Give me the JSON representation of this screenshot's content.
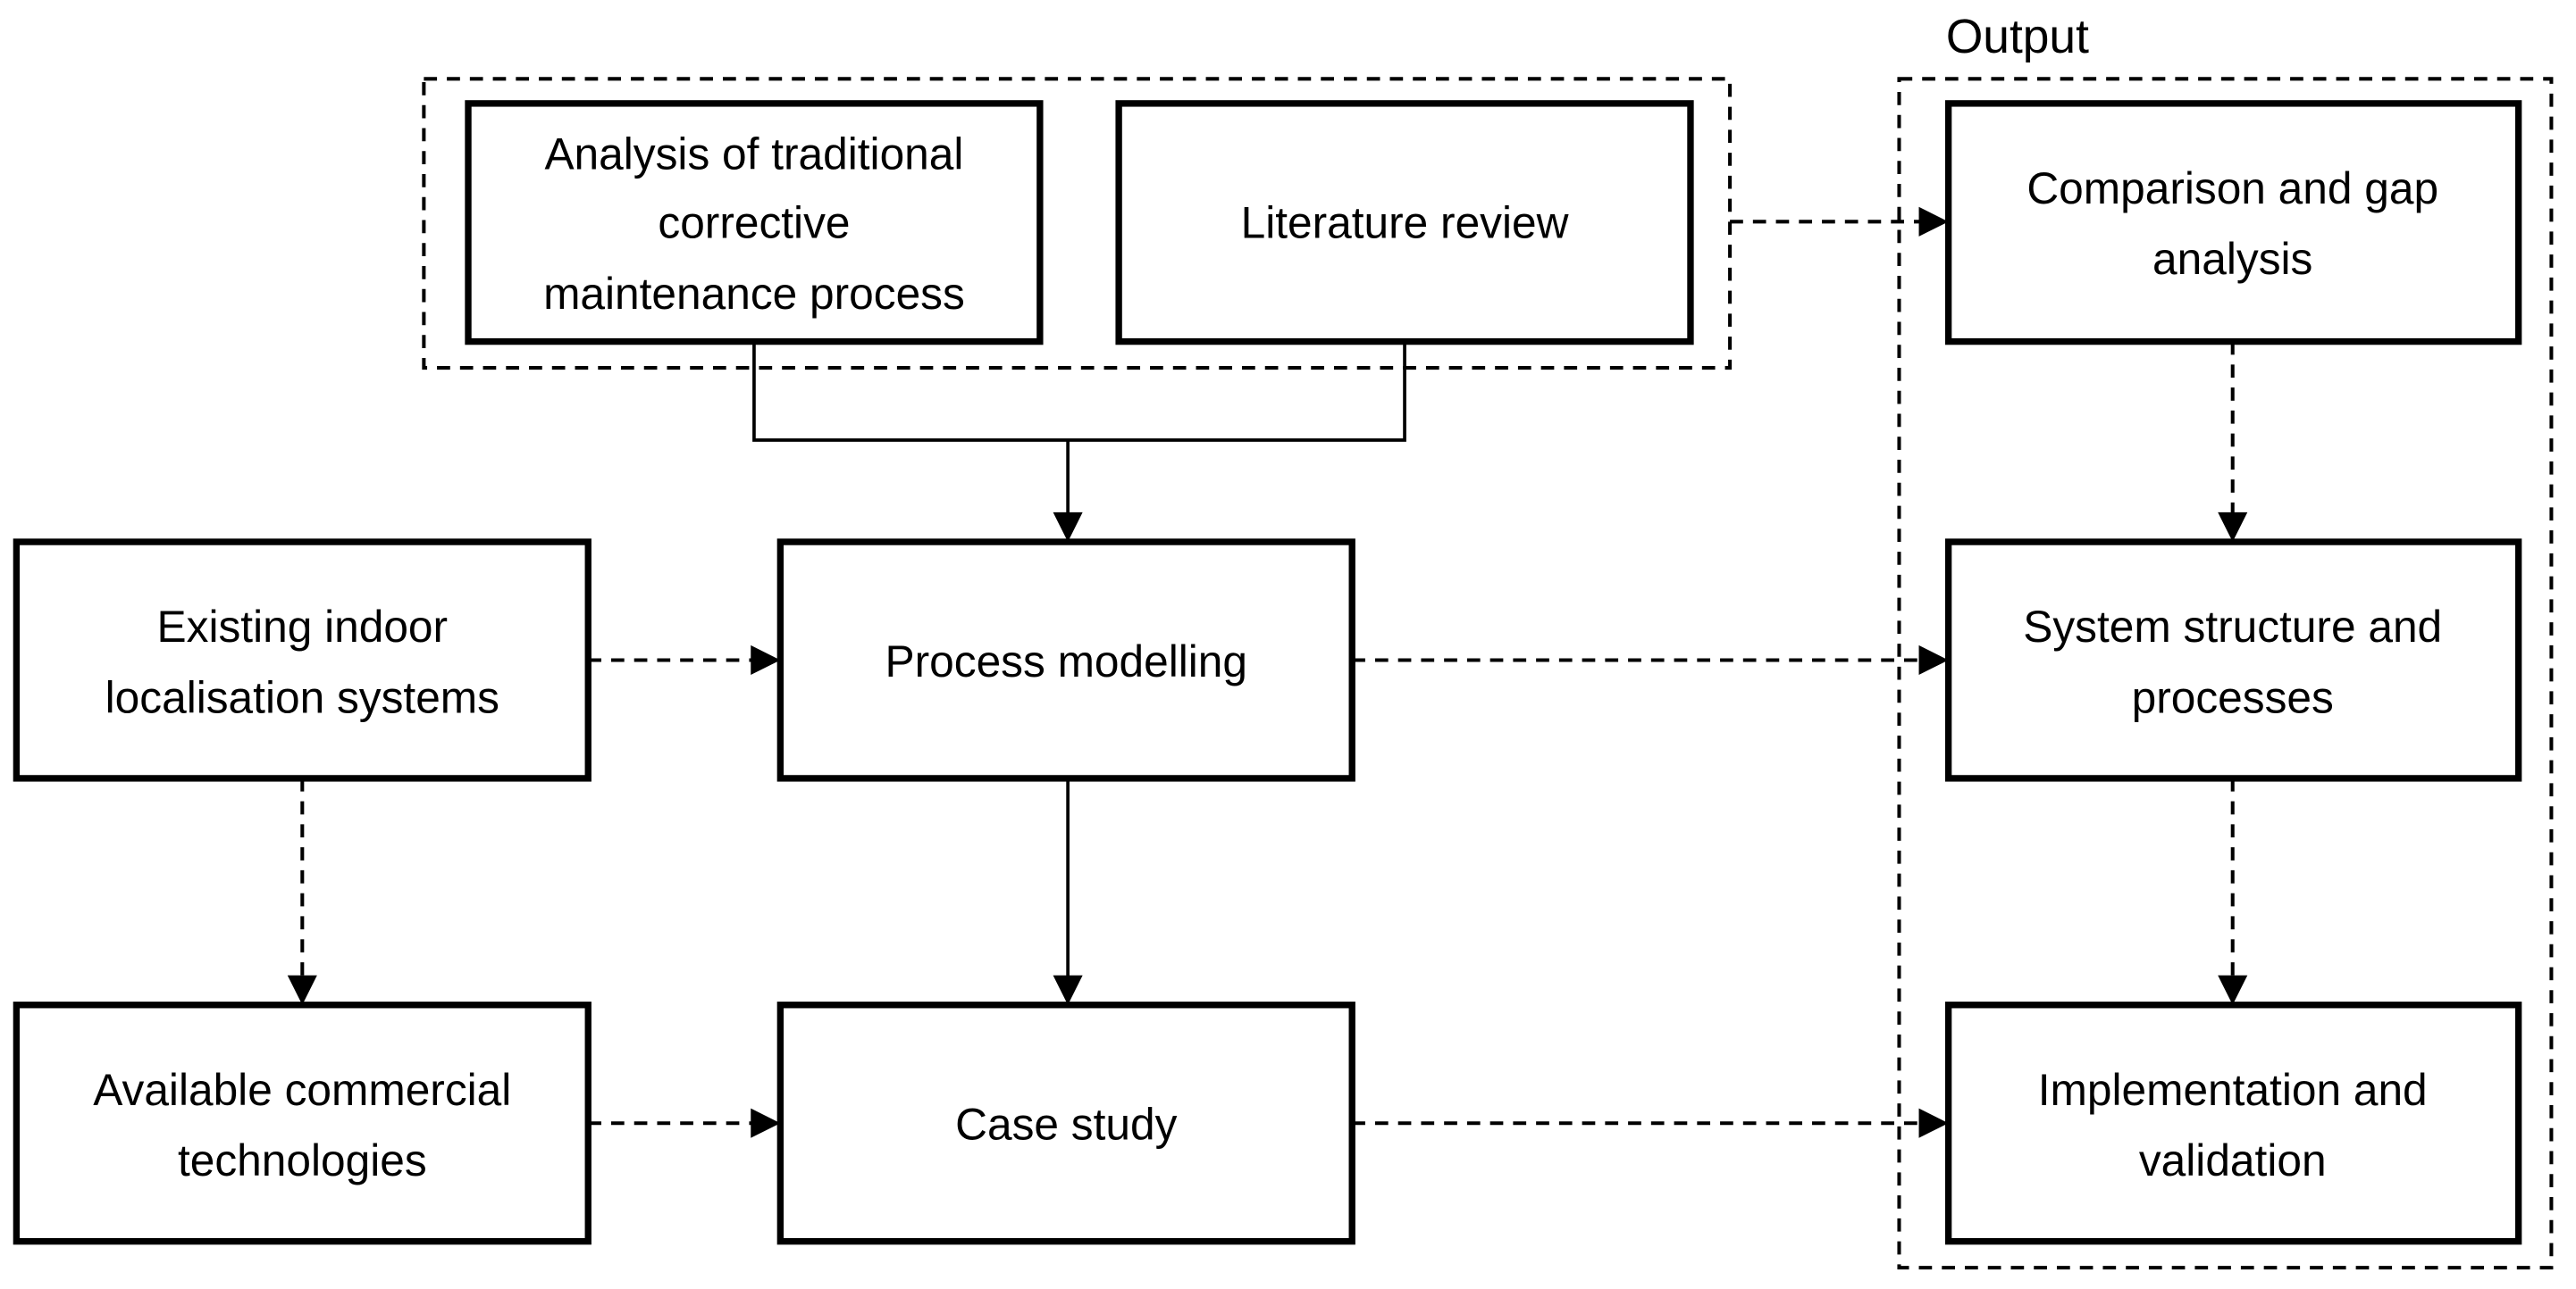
{
  "diagram": {
    "groups": {
      "input": {
        "label": ""
      },
      "output": {
        "label": "Output"
      }
    },
    "nodes": {
      "analysis": {
        "lines": [
          "Analysis of traditional",
          "corrective",
          "maintenance process"
        ]
      },
      "literature": {
        "lines": [
          "Literature review"
        ]
      },
      "existing": {
        "lines": [
          "Existing indoor",
          "localisation systems"
        ]
      },
      "process": {
        "lines": [
          "Process modelling"
        ]
      },
      "available": {
        "lines": [
          "Available commercial",
          "technologies"
        ]
      },
      "case": {
        "lines": [
          "Case study"
        ]
      },
      "comparison": {
        "lines": [
          "Comparison and gap",
          "analysis"
        ]
      },
      "system": {
        "lines": [
          "System structure and",
          "processes"
        ]
      },
      "implementation": {
        "lines": [
          "Implementation and",
          "validation"
        ]
      }
    },
    "edges": [
      {
        "from": "analysis+literature",
        "to": "process",
        "style": "solid"
      },
      {
        "from": "process",
        "to": "case",
        "style": "solid"
      },
      {
        "from": "existing",
        "to": "process",
        "style": "dashed"
      },
      {
        "from": "existing",
        "to": "available",
        "style": "dashed"
      },
      {
        "from": "available",
        "to": "case",
        "style": "dashed"
      },
      {
        "from": "input-group",
        "to": "comparison",
        "style": "dashed"
      },
      {
        "from": "process",
        "to": "system",
        "style": "dashed"
      },
      {
        "from": "case",
        "to": "implementation",
        "style": "dashed"
      },
      {
        "from": "comparison",
        "to": "system",
        "style": "dashed"
      },
      {
        "from": "system",
        "to": "implementation",
        "style": "dashed"
      }
    ]
  }
}
